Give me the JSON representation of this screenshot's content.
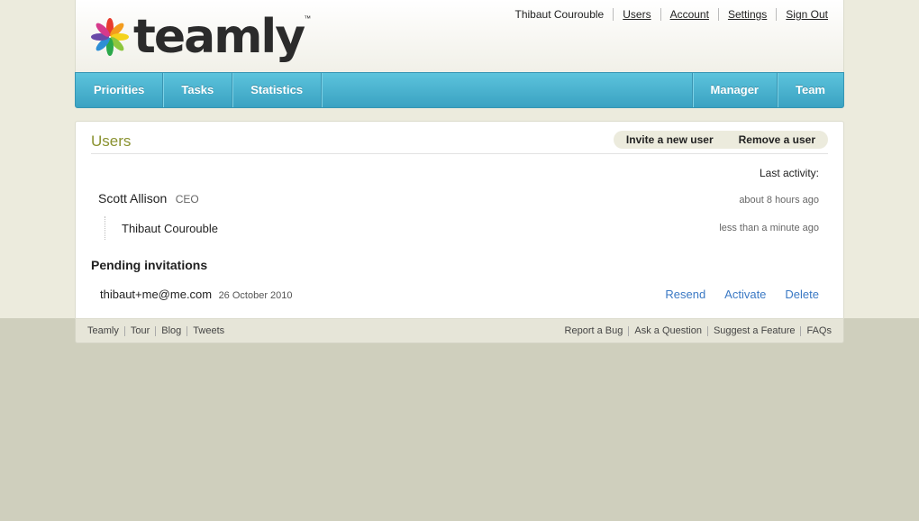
{
  "brand": {
    "name": "teamly",
    "tm": "™",
    "logo_icon": "pinwheel-logo-icon"
  },
  "user_nav": {
    "current_user": "Thibaut Courouble",
    "links": [
      "Users",
      "Account",
      "Settings",
      "Sign Out"
    ]
  },
  "main_nav": {
    "left": [
      "Priorities",
      "Tasks",
      "Statistics"
    ],
    "right": [
      "Manager",
      "Team"
    ]
  },
  "panel": {
    "title": "Users",
    "actions": [
      "Invite a new user",
      "Remove a user"
    ],
    "last_activity_label": "Last activity:",
    "manager": {
      "name": "Scott Allison",
      "role": "CEO",
      "last_activity": "about 8 hours ago"
    },
    "members": [
      {
        "name": "Thibaut Courouble",
        "last_activity": "less than a minute ago"
      }
    ],
    "pending_title": "Pending invitations",
    "invitations": [
      {
        "email": "thibaut+me@me.com",
        "date": "26 October 2010",
        "actions": [
          "Resend",
          "Activate",
          "Delete"
        ]
      }
    ]
  },
  "footer": {
    "left_links": [
      "Teamly",
      "Tour",
      "Blog",
      "Tweets"
    ],
    "right_links": [
      "Report a Bug",
      "Ask a Question",
      "Suggest a Feature",
      "FAQs"
    ]
  },
  "colors": {
    "nav_blue": "#4ab3d0",
    "title_olive": "#8a9230",
    "link_blue": "#3b79c4",
    "page_bg": "#ecebdd",
    "lower_bg": "#cfcfbd"
  }
}
